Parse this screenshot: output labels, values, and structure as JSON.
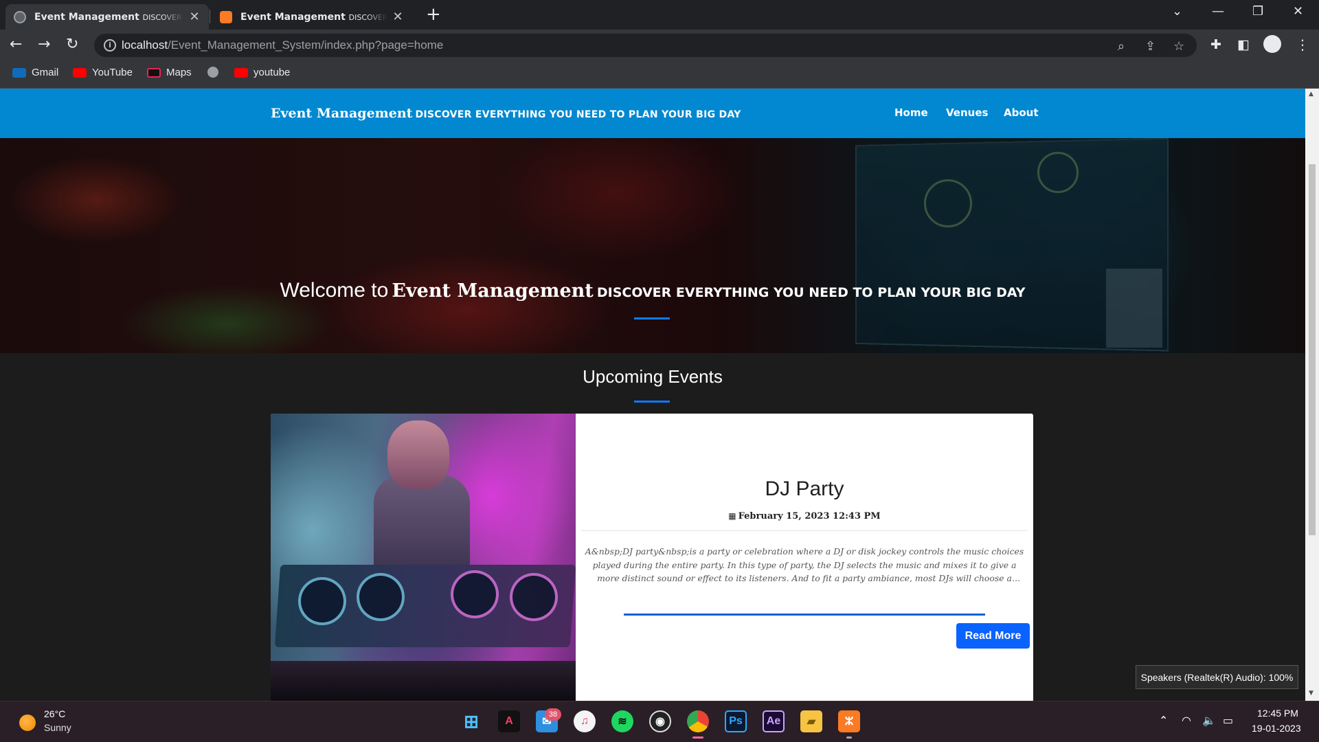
{
  "browser": {
    "tabs": [
      {
        "title": "Event Management",
        "subtitle": "DISCOVER EVE",
        "active": true
      },
      {
        "title": "Event Management",
        "subtitle": "DISCOVER EVE",
        "active": false
      }
    ],
    "close_glyph": "✕",
    "new_tab_glyph": "+",
    "window_controls": {
      "list": "⌄",
      "minimize": "—",
      "restore": "❐",
      "close": "✕"
    },
    "url_host": "localhost",
    "url_path": "/Event_Management_System/index.php?page=home",
    "bookmarks": [
      {
        "label": "Gmail",
        "icon": "outlook-icon",
        "color": "#0f6cbd"
      },
      {
        "label": "YouTube",
        "icon": "youtube-icon",
        "color": "#ff0000"
      },
      {
        "label": "Maps",
        "icon": "maps-icon",
        "color": "#111111"
      },
      {
        "label": "",
        "icon": "globe-icon",
        "color": "#9aa0a6"
      },
      {
        "label": "youtube",
        "icon": "youtube-icon",
        "color": "#ff0000"
      }
    ]
  },
  "site": {
    "brand_name": "Event Management",
    "brand_tagline": "DISCOVER EVERYTHING YOU NEED TO PLAN YOUR BIG DAY",
    "nav": [
      "Home",
      "Venues",
      "About"
    ],
    "hero_welcome": "Welcome to",
    "hero_name": "Event Management",
    "hero_tagline": "DISCOVER EVERYTHING YOU NEED TO PLAN YOUR BIG DAY",
    "section_title": "Upcoming Events",
    "accent_color": "#0288d1",
    "button_color": "#0a62ff"
  },
  "event": {
    "title": "DJ Party",
    "date": "February 15, 2023 12:43 PM",
    "description": "A&nbsp;DJ party&nbsp;is a party or celebration where a DJ or disk jockey controls the music choices played during the entire party. In this type of party, the DJ selects the music and mixes it to give a more distinct sound or effect to its listeners. And to fit a party ambiance, most DJs will choose a dance tune and creates...",
    "read_more": "Read More"
  },
  "toast": "Speakers (Realtek(R) Audio): 100%",
  "taskbar": {
    "weather_temp": "26°C",
    "weather_desc": "Sunny",
    "mail_badge": "38",
    "apps": [
      "windows-start",
      "affinity",
      "mail",
      "itunes",
      "spotify",
      "obs",
      "chrome",
      "photoshop",
      "after-effects",
      "file-explorer",
      "xampp"
    ],
    "time": "12:45 PM",
    "date": "19-01-2023"
  }
}
